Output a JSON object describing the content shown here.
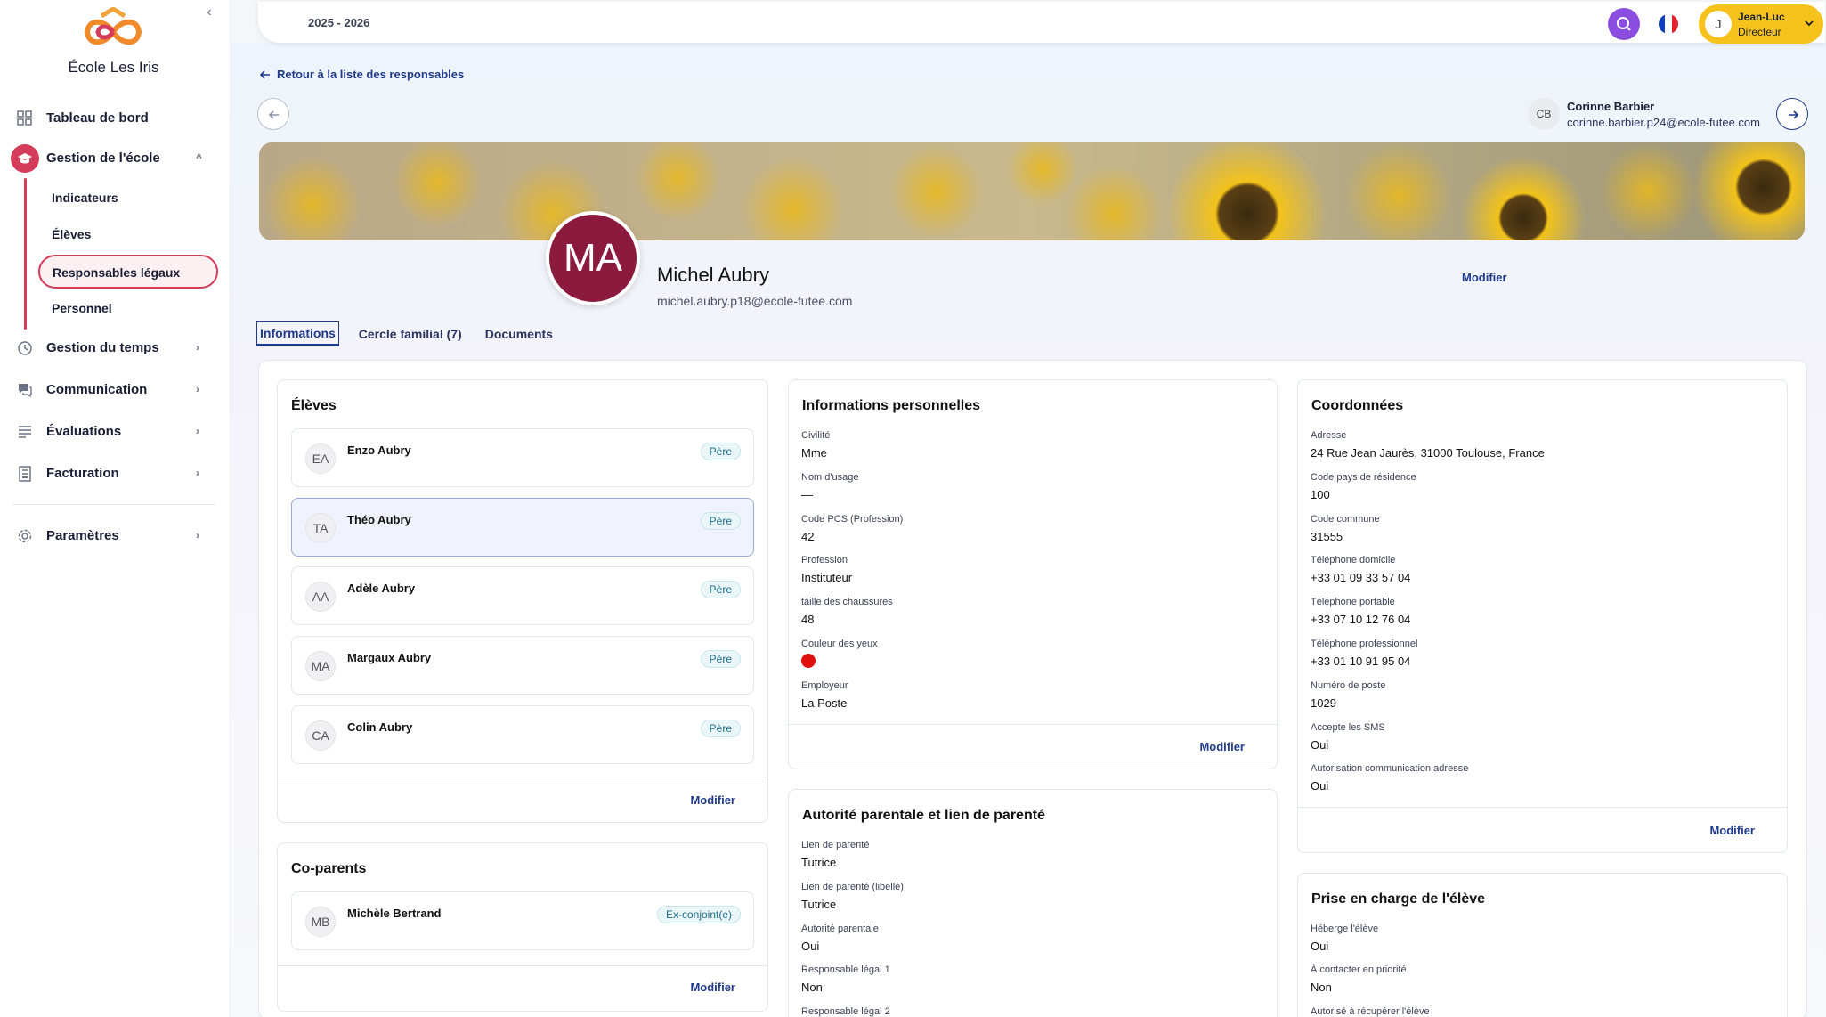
{
  "school_name": "École Les Iris",
  "sidebar": {
    "items": [
      {
        "label": "Tableau de bord"
      },
      {
        "label": "Gestion de l'école"
      },
      {
        "label": "Gestion du temps"
      },
      {
        "label": "Communication"
      },
      {
        "label": "Évaluations"
      },
      {
        "label": "Facturation"
      },
      {
        "label": "Paramètres"
      }
    ],
    "subitems": [
      {
        "label": "Indicateurs"
      },
      {
        "label": "Élèves"
      },
      {
        "label": "Responsables légaux"
      },
      {
        "label": "Personnel"
      }
    ]
  },
  "topbar": {
    "year": "2025 - 2026",
    "user_initial": "J",
    "user_name": "Jean-Luc",
    "user_role": "Directeur"
  },
  "back_link": "Retour à la liste des responsables",
  "next_user": {
    "initials": "CB",
    "name": "Corinne Barbier",
    "email": "corinne.barbier.p24@ecole-futee.com"
  },
  "profile": {
    "initials": "MA",
    "name": "Michel Aubry",
    "email": "michel.aubry.p18@ecole-futee.com",
    "edit_label": "Modifier"
  },
  "tabs": [
    {
      "label": "Informations"
    },
    {
      "label": "Cercle familial (7)"
    },
    {
      "label": "Documents"
    }
  ],
  "eleves": {
    "title": "Élèves",
    "items": [
      {
        "initials": "EA",
        "name": "Enzo Aubry",
        "role": "Père"
      },
      {
        "initials": "TA",
        "name": "Théo Aubry",
        "role": "Père"
      },
      {
        "initials": "AA",
        "name": "Adèle Aubry",
        "role": "Père"
      },
      {
        "initials": "MA",
        "name": "Margaux Aubry",
        "role": "Père"
      },
      {
        "initials": "CA",
        "name": "Colin Aubry",
        "role": "Père"
      }
    ],
    "edit": "Modifier"
  },
  "coparents": {
    "title": "Co-parents",
    "items": [
      {
        "initials": "MB",
        "name": "Michèle Bertrand",
        "role": "Ex-conjoint(e)"
      }
    ],
    "edit": "Modifier"
  },
  "infos_perso": {
    "title": "Informations personnelles",
    "fields": [
      {
        "label": "Civilité",
        "value": "Mme"
      },
      {
        "label": "Nom d'usage",
        "value": "—"
      },
      {
        "label": "Code PCS (Profession)",
        "value": "42"
      },
      {
        "label": "Profession",
        "value": "Instituteur"
      },
      {
        "label": "taille des chaussures",
        "value": "48"
      },
      {
        "label": "Couleur des yeux",
        "value": ""
      },
      {
        "label": "Employeur",
        "value": "La Poste"
      }
    ],
    "eye_color": "#e01010",
    "edit": "Modifier"
  },
  "autorite": {
    "title": "Autorité parentale et lien de parenté",
    "fields": [
      {
        "label": "Lien de parenté",
        "value": "Tutrice"
      },
      {
        "label": "Lien de parenté (libellé)",
        "value": "Tutrice"
      },
      {
        "label": "Autorité parentale",
        "value": "Oui"
      },
      {
        "label": "Responsable légal 1",
        "value": "Non"
      },
      {
        "label": "Responsable légal 2",
        "value": ""
      }
    ]
  },
  "coordonnees": {
    "title": "Coordonnées",
    "fields": [
      {
        "label": "Adresse",
        "value": "24 Rue Jean Jaurès, 31000 Toulouse, France"
      },
      {
        "label": "Code pays de résidence",
        "value": "100"
      },
      {
        "label": "Code commune",
        "value": "31555"
      },
      {
        "label": "Téléphone domicile",
        "value": "+33 01 09 33 57 04"
      },
      {
        "label": "Téléphone portable",
        "value": "+33 07 10 12 76 04"
      },
      {
        "label": "Téléphone professionnel",
        "value": "+33 01 10 91 95 04"
      },
      {
        "label": "Numéro de poste",
        "value": "1029"
      },
      {
        "label": "Accepte les SMS",
        "value": "Oui"
      },
      {
        "label": "Autorisation communication adresse",
        "value": "Oui"
      }
    ],
    "edit": "Modifier"
  },
  "prise_en_charge": {
    "title": "Prise en charge de l'élève",
    "fields": [
      {
        "label": "Héberge l'élève",
        "value": "Oui"
      },
      {
        "label": "À contacter en priorité",
        "value": "Non"
      },
      {
        "label": "Autorisé à récupérer l'élève",
        "value": ""
      }
    ]
  }
}
